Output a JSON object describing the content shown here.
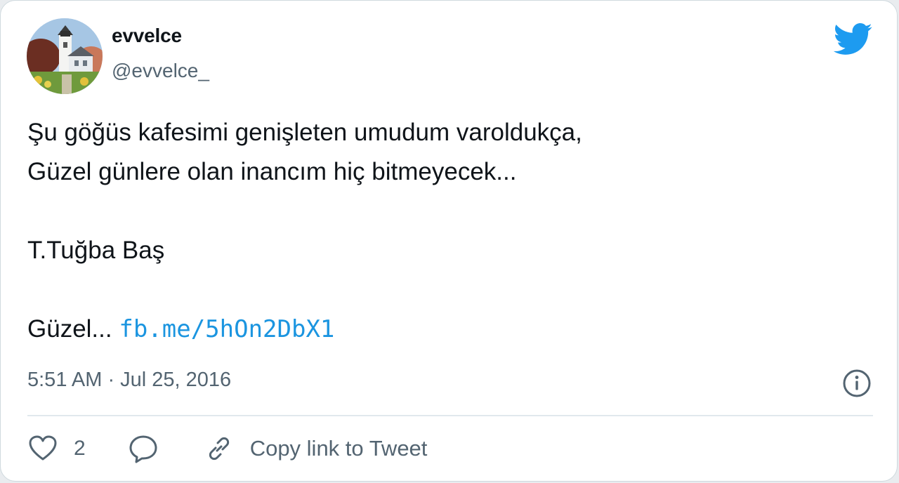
{
  "user": {
    "display_name": "evvelce",
    "handle": "@evvelce_",
    "avatar_icon": "lighthouse-avatar"
  },
  "tweet": {
    "lines": [
      "Şu göğüs kafesimi genişleten umudum varoldukça,",
      "Güzel günlere olan inancım hiç bitmeyecek...",
      "",
      "T.Tuğba Baş",
      "",
      "Güzel..."
    ],
    "link_text": "fb.me/5hOn2DbX1",
    "timestamp": "5:51 AM · Jul 25, 2016"
  },
  "actions": {
    "like_count": "2",
    "copy_link_label": "Copy link to Tweet"
  },
  "icons": {
    "brand": "twitter-bird-icon",
    "info": "info-icon",
    "like": "heart-icon",
    "reply": "reply-bubble-icon",
    "copy": "link-icon"
  },
  "colors": {
    "brand_blue": "#1d9bf0",
    "link_blue": "#1b95e0",
    "secondary_text": "#536471",
    "primary_text": "#0f1419"
  }
}
